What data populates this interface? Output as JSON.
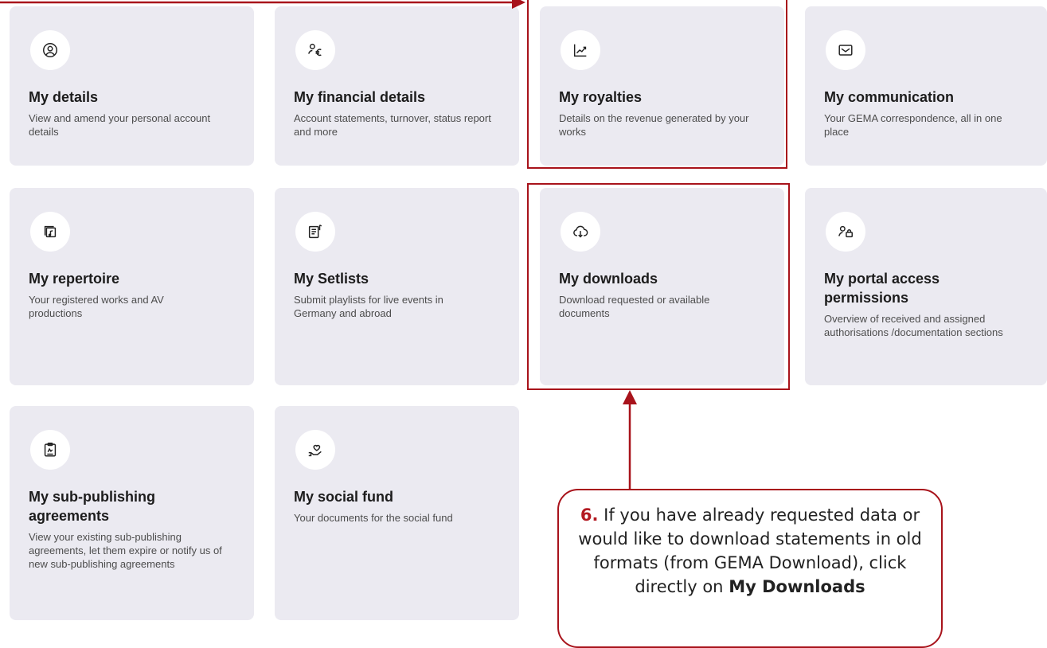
{
  "cards": [
    {
      "id": "my-details",
      "icon": "user-circle-icon",
      "title": "My details",
      "desc": "View and amend your personal account details"
    },
    {
      "id": "my-financial-details",
      "icon": "user-euro-icon",
      "title": "My financial details",
      "desc": "Account statements, turnover, status report and more"
    },
    {
      "id": "my-royalties",
      "icon": "chart-trend-icon",
      "title": "My royalties",
      "desc": "Details on the revenue generated by your works"
    },
    {
      "id": "my-communication",
      "icon": "envelope-icon",
      "title": "My communication",
      "desc": "Your GEMA correspondence, all in one place"
    },
    {
      "id": "my-repertoire",
      "icon": "music-files-icon",
      "title": "My repertoire",
      "desc": "Your registered works and AV productions"
    },
    {
      "id": "my-setlists",
      "icon": "setlist-icon",
      "title": "My Setlists",
      "desc": "Submit playlists for live events in Germany and abroad"
    },
    {
      "id": "my-downloads",
      "icon": "cloud-download-icon",
      "title": "My downloads",
      "desc": "Download requested or available documents"
    },
    {
      "id": "my-portal-access-permissions",
      "icon": "user-lock-icon",
      "title": "My portal access permissions",
      "desc": "Overview of received and assigned authorisations /documentation sections"
    },
    {
      "id": "my-sub-publishing-agreements",
      "icon": "clipboard-icon",
      "title": "My sub-publishing agreements",
      "desc": "View your existing sub-publishing agreements, let them expire or notify us of new sub-publishing agreements"
    },
    {
      "id": "my-social-fund",
      "icon": "hand-heart-icon",
      "title": "My social fund",
      "desc": "Your documents for the social fund"
    }
  ],
  "callout": {
    "number": "6.",
    "text": "If you have already requested data or would like to download statements in old formats (from GEMA Download), click directly on",
    "emphasis": "My Downloads"
  },
  "colors": {
    "card_bg": "#ebeaf1",
    "highlight": "#a8131b",
    "callout_number": "#b31a22"
  }
}
